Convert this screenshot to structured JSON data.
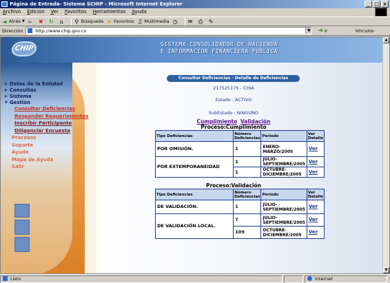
{
  "window": {
    "title": "Página de Entrada- Sistema SCHIP - Microsoft Internet Explorer",
    "buttons": [
      "_",
      "□",
      "×"
    ]
  },
  "menu": [
    "Archivo",
    "Edición",
    "Ver",
    "Favoritos",
    "Herramientas",
    "Ayuda"
  ],
  "toolbar": {
    "back": "Atrás",
    "search": "Búsqueda",
    "favorites": "Favoritos",
    "multimedia": "Multimedia"
  },
  "address": {
    "label": "Dirección",
    "url": "http://www.chip.gov.co",
    "go": "Ir",
    "links": "Vínculos"
  },
  "banner": {
    "logo": "CHIP",
    "line1": "SISTEMA CONSOLIDADOR DE HACIENDA",
    "line2": "E INFORMACION FINANCIERA PUBLICA"
  },
  "nav": {
    "items": [
      "Datos de la Entidad",
      "Consultas",
      "Sistema",
      "Gestión"
    ],
    "sub": [
      {
        "label": "Consultar Deficiencias",
        "style": "red"
      },
      {
        "label": "Responder Requerimientos",
        "style": "red"
      },
      {
        "label": "Inscribir Participante",
        "style": "dark"
      },
      {
        "label": "Diligenciar Encuesta",
        "style": "dark"
      }
    ],
    "extra": [
      "Procesos",
      "Soporte",
      "Ayuda",
      "Mapa de Ayuda",
      "Salir"
    ]
  },
  "content": {
    "header": "Consultar Deficiencias - Detalle de Deficiencias presentadas",
    "entity": "217525175 - CHIA",
    "estado": "Estado : ACTIVO",
    "subestado": "SubEstado : NINGUNO",
    "tab1": "Cumplimiento",
    "tab2": "Validación",
    "section1": "Proceso:Cumplimiento",
    "section2": "Proceso:Validación",
    "columns": {
      "tipo": "Tipo Deficiencias",
      "numero": "Número Deficiencias",
      "periodo": "Periodo",
      "ver": "Ver Detalle"
    },
    "ver_label": "Ver",
    "cumplimiento_rows": [
      {
        "tipo": "POR OMISIÓN.",
        "numero": "1",
        "periodo": "ENERO-MARZO/2005"
      },
      {
        "tipo": "POR EXTEMPORANEIDAD",
        "numero": "1",
        "periodo": "JULIO-SEPTIEMBRE/2005"
      },
      {
        "tipo": "",
        "numero": "1",
        "periodo": "OCTUBRE-DICIEMBRE/2005"
      }
    ],
    "validacion_rows": [
      {
        "tipo": "DE VALIDACIÓN.",
        "numero": "1",
        "periodo": "JULIO-SEPTIEMBRE/2005"
      },
      {
        "tipo": "DE VALIDACIÓN LOCAL.",
        "numero": "7",
        "periodo": "JULIO-SEPTIEMBRE/2005"
      },
      {
        "tipo": "",
        "numero": "109",
        "periodo": "OCTUBRE-DICIEMBRE/2005"
      }
    ]
  },
  "status": {
    "left": "Listo",
    "zone": "Internet"
  }
}
